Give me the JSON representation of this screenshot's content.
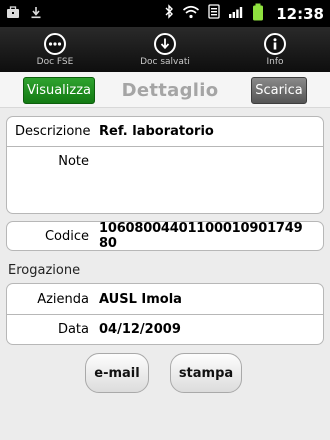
{
  "status_bar": {
    "time": "12:38",
    "icons": [
      "briefcase-icon",
      "download-icon",
      "bluetooth-icon",
      "wifi-icon",
      "data-icon",
      "signal-icon",
      "battery-icon"
    ]
  },
  "nav": {
    "items": [
      {
        "label": "Doc FSE",
        "icon": "ellipsis-circle-icon"
      },
      {
        "label": "Doc salvati",
        "icon": "download-circle-icon"
      },
      {
        "label": "Info",
        "icon": "info-circle-icon"
      }
    ]
  },
  "header": {
    "visualizza_label": "Visualizza",
    "title": "Dettaglio",
    "scarica_label": "Scarica",
    "visualizza_color": "#1f8f1f",
    "scarica_color": "#6e6e6e"
  },
  "fields": {
    "descrizione_label": "Descrizione",
    "descrizione_value": "Ref. laboratorio",
    "note_label": "Note",
    "note_value": "",
    "codice_label": "Codice",
    "codice_value": "10608004401100010901749​80"
  },
  "erogazione": {
    "section_label": "Erogazione",
    "azienda_label": "Azienda",
    "azienda_value": "AUSL Imola",
    "data_label": "Data",
    "data_value": "04/12/2009"
  },
  "actions": {
    "email_label": "e-mail",
    "stampa_label": "stampa"
  }
}
